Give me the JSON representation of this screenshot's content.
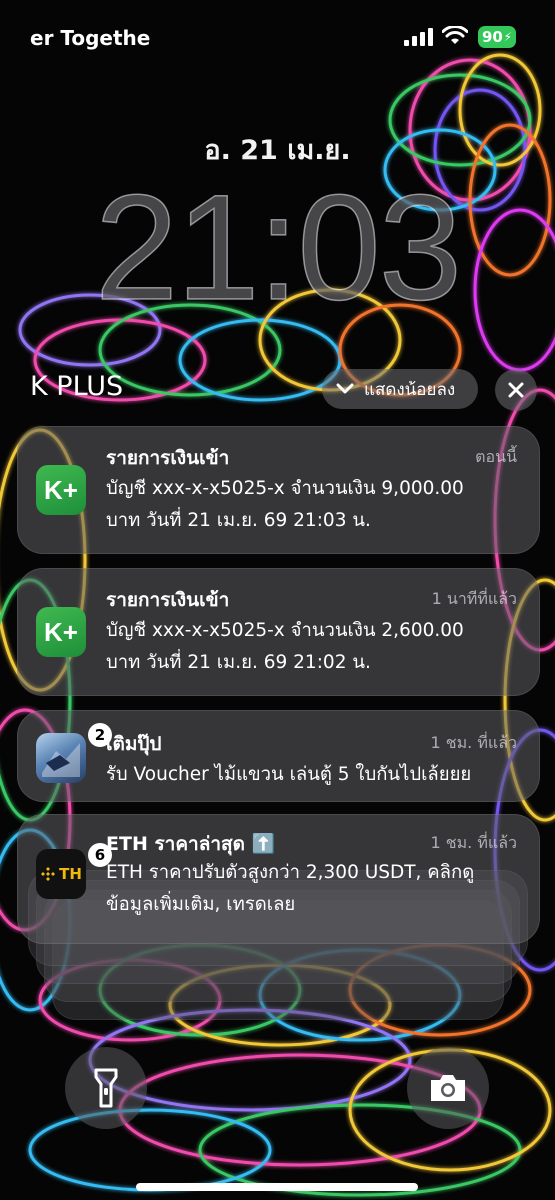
{
  "status_bar": {
    "carrier": "er Togethe",
    "battery": "90"
  },
  "lock": {
    "date": "อ. 21 เม.ย.",
    "time": "21:03"
  },
  "group": {
    "title": "K PLUS",
    "show_less_label": "แสดงน้อยลง"
  },
  "notifications": [
    {
      "app": "K PLUS",
      "icon_text": "K+",
      "title": "รายการเงินเข้า",
      "time": "ตอนนี้",
      "body_line1": "บัญชี xxx-x-x5025-x  จำนวนเงิน 9,000.00",
      "body_line2": "บาท  วันที่ 21 เม.ย. 69  21:03 น."
    },
    {
      "app": "K PLUS",
      "icon_text": "K+",
      "title": "รายการเงินเข้า",
      "time": "1 นาทีที่แล้ว",
      "body_line1": "บัญชี xxx-x-x5025-x  จำนวนเงิน 2,600.00",
      "body_line2": "บาท  วันที่ 21 เม.ย. 69  21:02 น."
    },
    {
      "app": "game",
      "badge": "2",
      "title": "เติมปุ๊ป",
      "time": "1 ชม. ที่แล้ว",
      "body_line1": "รับ Voucher ไม้แขวน เล่นตู้ 5 ใบกันไปเล้ยยย"
    },
    {
      "app": "TH",
      "badge": "6",
      "icon_text": "TH",
      "title": "ETH ราคาล่าสุด ⬆️",
      "time": "1 ชม. ที่แล้ว",
      "body_line1": "ETH ราคาปรับตัวสูงกว่า 2,300 USDT, คลิกดู",
      "body_line2": "ข้อมูลเพิ่มเติม, เทรดเลย"
    }
  ],
  "icons": [
    "signal-icon",
    "wifi-icon",
    "battery-icon",
    "chevron-down-icon",
    "close-icon",
    "flashlight-icon",
    "camera-icon"
  ],
  "colors": {
    "battery": "#34c759",
    "kplus": "#2ea043",
    "binance": "#f0b90b"
  }
}
